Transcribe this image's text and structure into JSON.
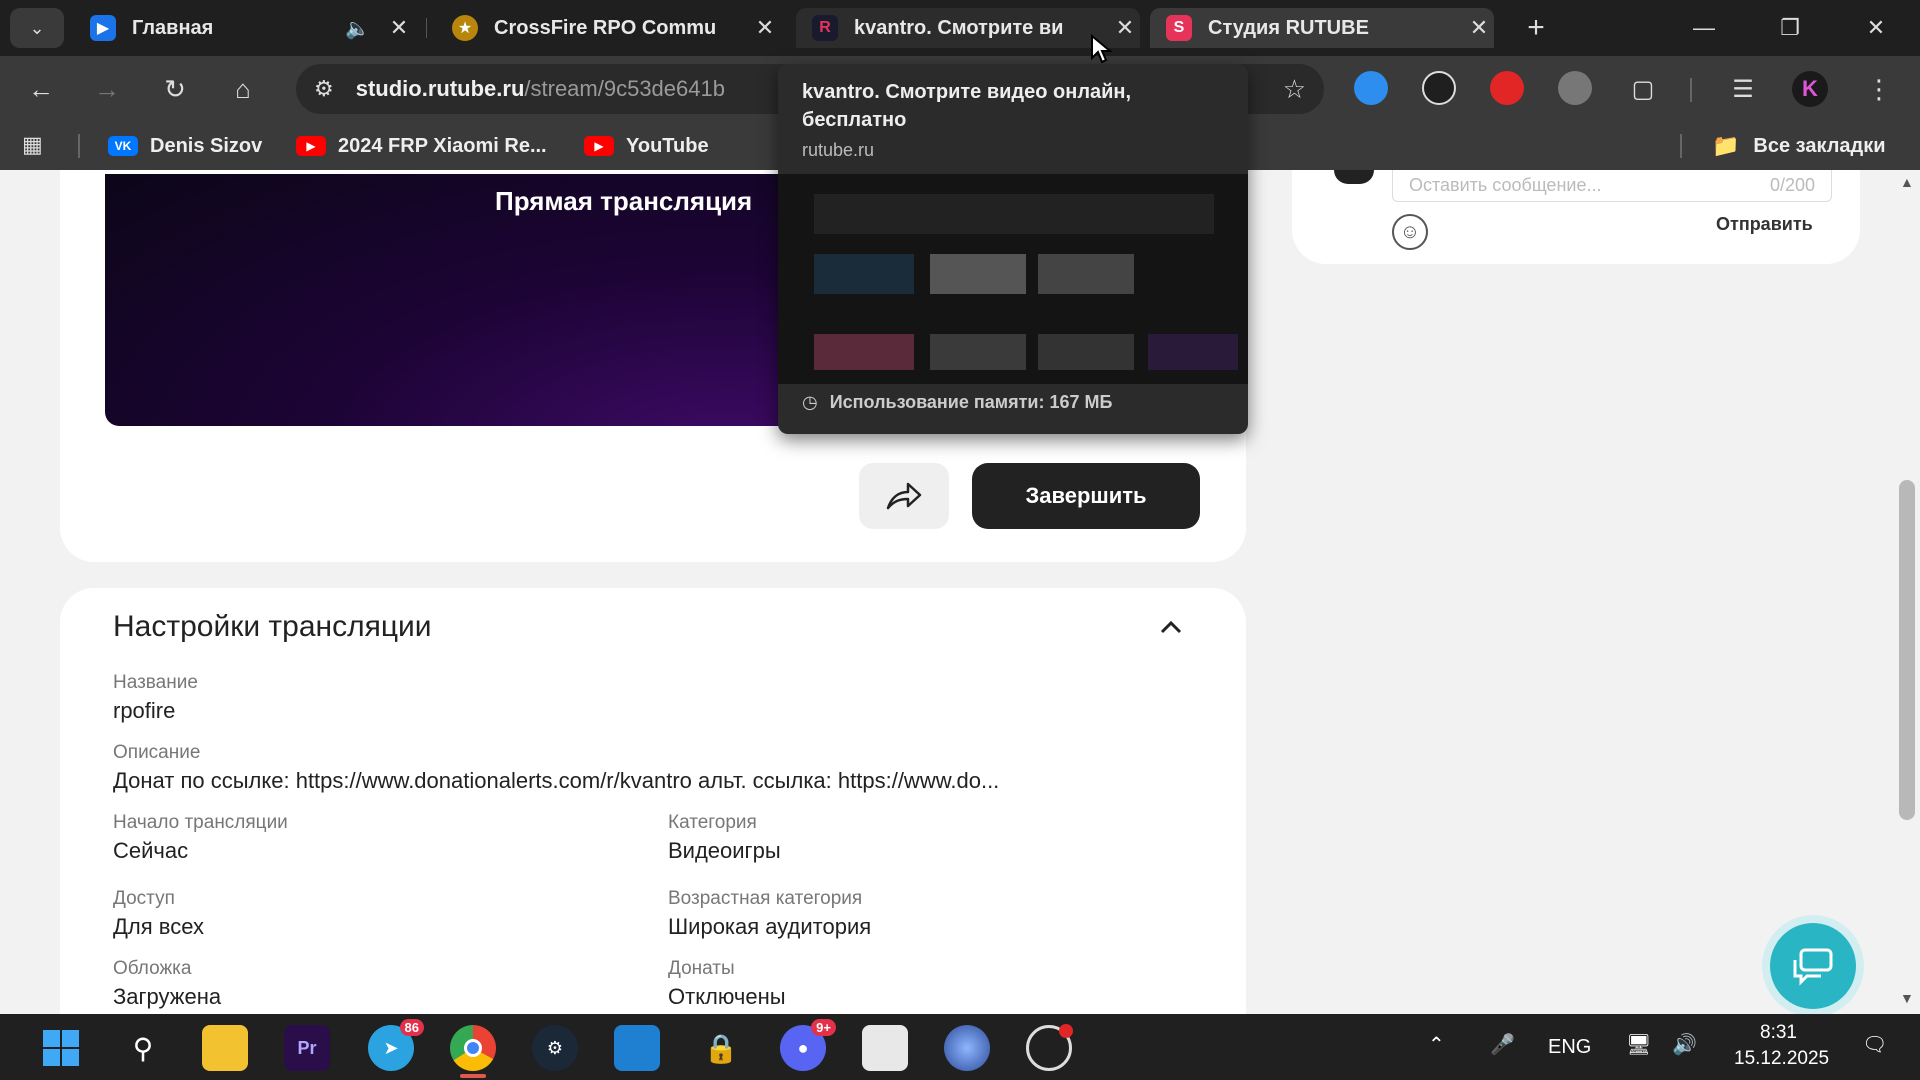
{
  "tabs": [
    {
      "title": "Главная",
      "favicon": "rutube-play-icon",
      "color": "#1a73e8"
    },
    {
      "title": "CrossFire RPO Commu",
      "favicon": "crossfire-icon",
      "color": "#b8860b"
    },
    {
      "title": "kvantro. Смотрите ви",
      "favicon": "rutube-r-icon",
      "color": "#1a1a2e"
    },
    {
      "title": "Студия RUTUBE",
      "favicon": "rutube-studio-icon",
      "color": "#e6335a"
    }
  ],
  "address": {
    "host": "studio.rutube.ru",
    "path": "/stream/9c53de641b"
  },
  "bookmarks": {
    "items": [
      "Denis Sizov",
      "2024 FRP Xiaomi Re...",
      "YouTube"
    ],
    "all": "Все закладки"
  },
  "hovercard": {
    "title": "kvantro. Смотрите видео онлайн, бесплатно",
    "host": "rutube.ru",
    "memory": "Использование памяти: 167 МБ"
  },
  "video": {
    "overlay": "Прямая трансляция"
  },
  "actions": {
    "finish": "Завершить"
  },
  "chat": {
    "placeholder": "Оставить сообщение...",
    "counter": "0/200",
    "send": "Отправить"
  },
  "settings": {
    "title": "Настройки трансляции",
    "fields": [
      {
        "label": "Название",
        "value": "rpofire"
      },
      {
        "label": "Описание",
        "value": "Донат по ссылке: https://www.donationalerts.com/r/kvantro альт. ссылка: https://www.do..."
      },
      {
        "label": "Начало трансляции",
        "value": "Сейчас"
      },
      {
        "label": "Категория",
        "value": "Видеоигры"
      },
      {
        "label": "Доступ",
        "value": "Для всех"
      },
      {
        "label": "Возрастная категория",
        "value": "Широкая аудитория"
      },
      {
        "label": "Обложка",
        "value": "Загружена"
      },
      {
        "label": "Донаты",
        "value": "Отключены"
      }
    ]
  },
  "taskbar": {
    "telegram_badge": "86",
    "discord_badge": "9+",
    "lang": "ENG",
    "time": "8:31",
    "date": "15.12.2025"
  },
  "colors": {
    "accent": "#2ab5c4",
    "dark_button": "#222222",
    "tab_bar": "#1f1f1f"
  }
}
